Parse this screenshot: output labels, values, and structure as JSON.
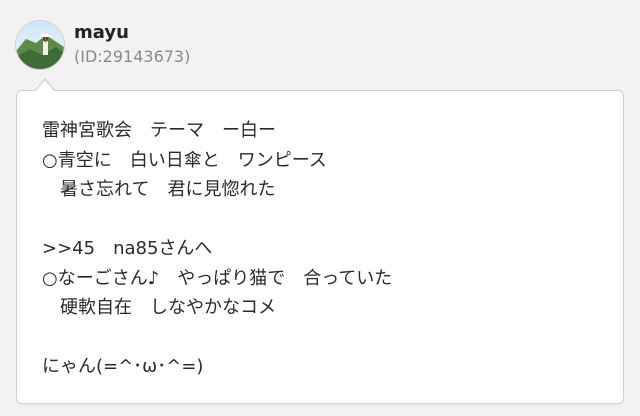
{
  "user": {
    "name": "mayu",
    "id": "(ID:29143673)"
  },
  "post": {
    "lines": [
      "雷神宮歌会　テーマ　ー白ー",
      "○青空に　白い日傘と　ワンピース",
      "　暑さ忘れて　君に見惚れた",
      "",
      ">>45　na85さんへ",
      "○なーごさん♪　やっぱり猫で　合っていた",
      "　硬軟自在　しなやかなコメ",
      "",
      "にゃん(=^･ω･^=)"
    ]
  },
  "colors": {
    "background": "#f2f2f2",
    "bubble": "#ffffff",
    "username": "#222222",
    "user_id": "#8a8a8a"
  },
  "icons": {
    "avatar": "avatar-photo-landscape"
  }
}
